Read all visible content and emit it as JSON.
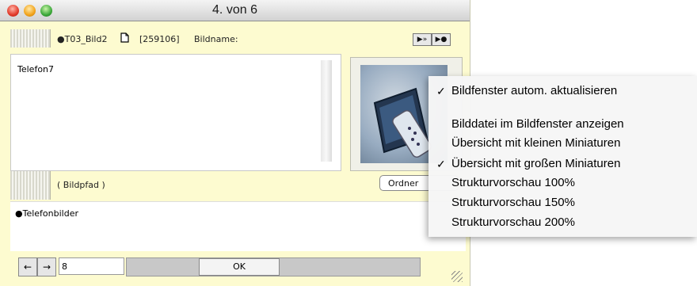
{
  "window": {
    "title": "4. von 6",
    "record_label": "●T03_Bild2",
    "record_id": "[259106]",
    "field_name_label": "Bildname:",
    "nav_buttons": [
      "▶»",
      "▶●"
    ],
    "image_name": "Telefon7",
    "path_label": "( Bildpfad )",
    "folder_button": "Ordner",
    "path_value": "●Telefonbilder",
    "record_number": "8",
    "ok_button": "OK",
    "prev_arrow": "←",
    "next_arrow": "→"
  },
  "menu": {
    "items": [
      {
        "label": "Bildfenster autom. aktualisieren",
        "checked": true
      },
      {
        "label": "Bilddatei im Bildfenster anzeigen",
        "checked": false
      },
      {
        "label": "Übersicht mit kleinen Miniaturen",
        "checked": false
      },
      {
        "label": "Übersicht mit großen Miniaturen",
        "checked": true
      },
      {
        "label": "Strukturvorschau 100%",
        "checked": false
      },
      {
        "label": "Strukturvorschau 150%",
        "checked": false
      },
      {
        "label": "Strukturvorschau 200%",
        "checked": false
      }
    ],
    "check_mark": "✓"
  }
}
